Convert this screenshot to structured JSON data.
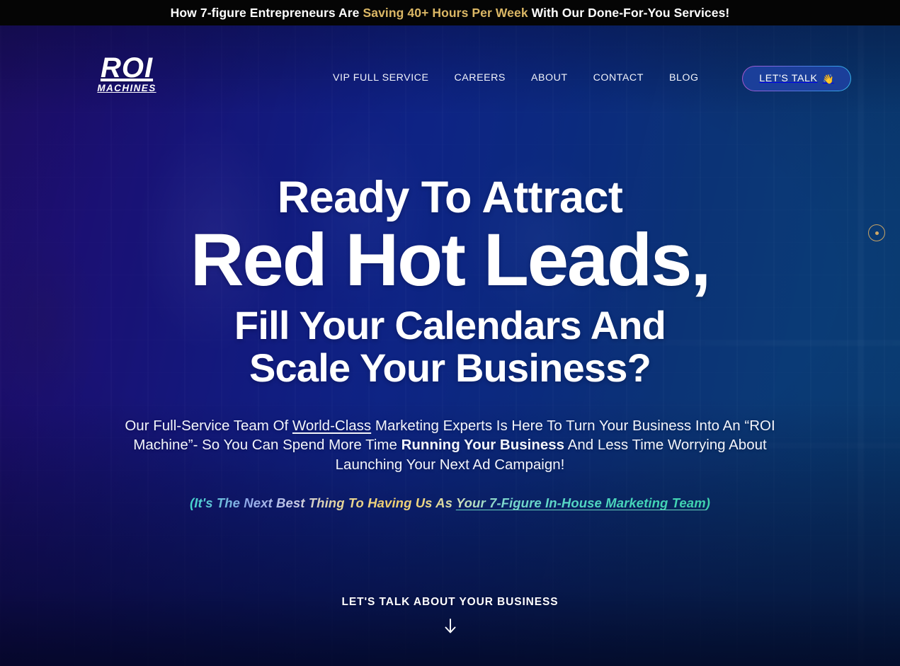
{
  "announcement": {
    "prefix": "How 7-figure Entrepreneurs Are ",
    "highlight": "Saving 40+ Hours Per Week",
    "suffix": " With Our Done-For-You Services!",
    "background_color": "#050505",
    "highlight_color": "#dbb765"
  },
  "header": {
    "logo": {
      "main": "ROI",
      "sub": "MACHINES"
    },
    "nav": [
      {
        "label": "VIP FULL SERVICE"
      },
      {
        "label": "CAREERS"
      },
      {
        "label": "ABOUT"
      },
      {
        "label": "CONTACT"
      },
      {
        "label": "BLOG"
      }
    ],
    "cta_button": {
      "label": "LET'S TALK",
      "emoji": "👋",
      "border_gradient_from": "#a855c9",
      "border_gradient_to": "#35b4e8"
    }
  },
  "hero": {
    "headline": {
      "line1": "Ready To Attract",
      "line2": "Red Hot Leads,",
      "line3": "Fill Your Calendars And",
      "line4": "Scale Your Business?"
    },
    "subcopy": {
      "part1": "Our Full-Service Team Of ",
      "underlined": "World-Class",
      "part2": " Marketing Experts Is Here To Turn Your Business Into An “ROI Machine”- So You Can Spend More Time ",
      "bold": "Running Your Business",
      "part3": " And Less Time Worrying About Launching Your Next Ad Campaign!"
    },
    "tagline": {
      "prefix": "(It's The Next Best Thing To Having Us As ",
      "link": "Your 7-Figure In-House Marketing Team",
      "suffix": ")",
      "gradient_start": "#44d6cc",
      "gradient_mid": "#f0cf6e",
      "gradient_end": "#3fd3ae"
    },
    "scroll_indicator": {
      "color": "#c9a465"
    },
    "cta": {
      "label": "LET'S TALK ABOUT YOUR BUSINESS",
      "arrow_icon": "arrow-down-icon"
    },
    "background": {
      "gradient_left": "#3a1f8f",
      "gradient_right": "#125f96",
      "description_not_text": ""
    }
  }
}
